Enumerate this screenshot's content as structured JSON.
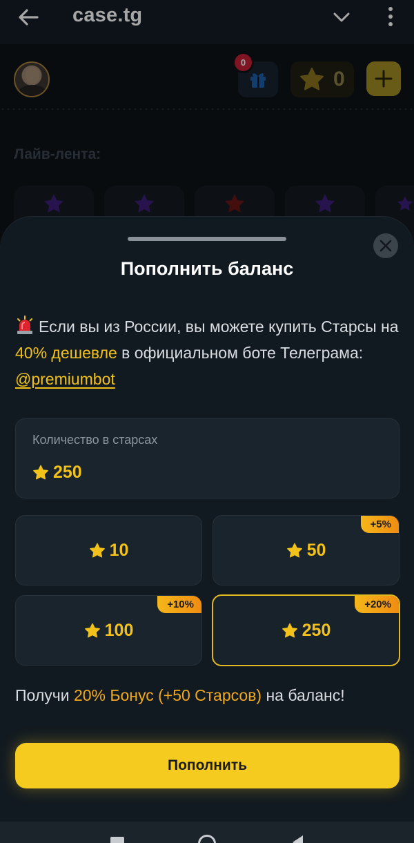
{
  "browser": {
    "title": "case.tg"
  },
  "header": {
    "gift_count": "0",
    "balance": "0"
  },
  "live": {
    "label": "Лайв-лента:",
    "cards": [
      "purple",
      "purple",
      "red",
      "purple",
      "purple"
    ]
  },
  "sheet": {
    "title": "Пополнить баланс",
    "notice": {
      "part1": "Если вы из России, вы можете купить Старсы на ",
      "highlight": "40% дешевле",
      "part2": " в официальном боте Телеграма: ",
      "link": "@premiumbot"
    },
    "amount": {
      "label": "Количество в старсах",
      "value": "250"
    },
    "options": [
      {
        "value": "10",
        "bonus": "",
        "selected": false
      },
      {
        "value": "50",
        "bonus": "+5%",
        "selected": false
      },
      {
        "value": "100",
        "bonus": "+10%",
        "selected": false
      },
      {
        "value": "250",
        "bonus": "+20%",
        "selected": true
      }
    ],
    "bonus_line": {
      "prefix": "Получи ",
      "highlight": "20% Бонус (+50 Старсов)",
      "suffix": " на баланс!"
    },
    "submit_label": "Пополнить"
  },
  "colors": {
    "accent": "#f5cb1f",
    "star": "#f2c21b",
    "bonus_gradient_end": "#f08c12",
    "badge": "#c42035"
  }
}
